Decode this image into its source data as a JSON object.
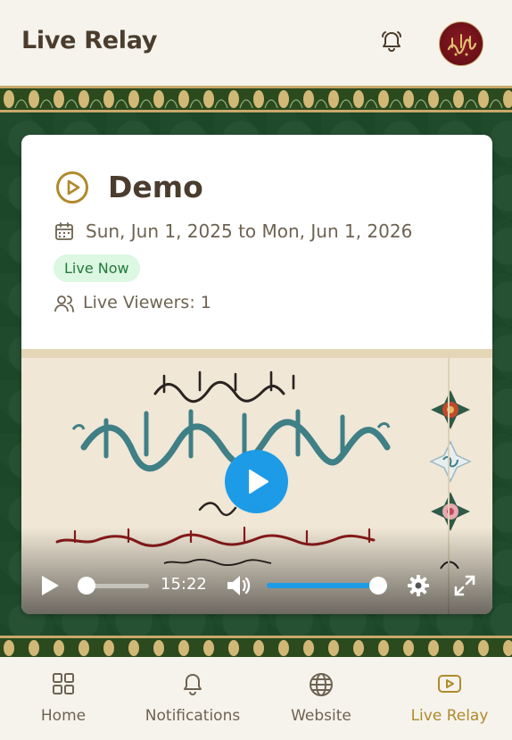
{
  "header": {
    "title": "Live Relay",
    "bell_icon": "bell-icon",
    "avatar_icon": "avatar-calligraphy-icon"
  },
  "event": {
    "title": "Demo",
    "dates": "Sun, Jun 1, 2025 to Mon, Jun 1, 2026",
    "status": "Live Now",
    "viewers": "Live Viewers: 1"
  },
  "player": {
    "time": "15:22",
    "progress": 0.0,
    "volume": 1.0,
    "icons": [
      "play-icon",
      "volume-icon",
      "settings-icon",
      "fullscreen-icon"
    ]
  },
  "nav": {
    "items": [
      {
        "label": "Home",
        "icon": "grid-icon"
      },
      {
        "label": "Notifications",
        "icon": "bell-icon"
      },
      {
        "label": "Website",
        "icon": "globe-icon"
      },
      {
        "label": "Live Relay",
        "icon": "video-play-icon"
      }
    ],
    "active": "Live Relay"
  },
  "colors": {
    "brand_text": "#4a3d2e",
    "accent_gold": "#b08a2c",
    "live_badge_bg": "#dcf7e2",
    "live_badge_text": "#237a3a",
    "player_blue": "#1e9be6",
    "background_green": "#1f4b2c"
  }
}
